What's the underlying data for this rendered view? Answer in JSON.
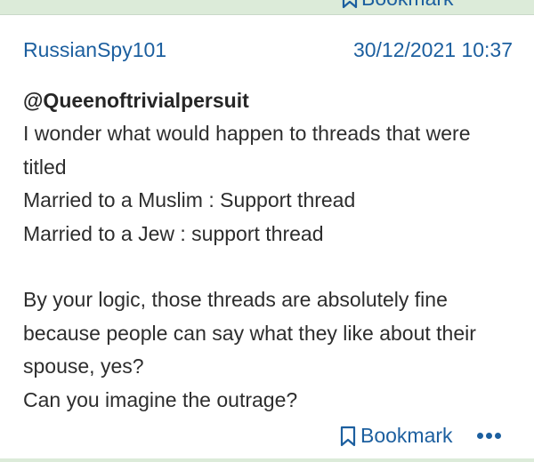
{
  "top_action": {
    "bookmark_label": "Bookmark"
  },
  "post": {
    "username": "RussianSpy101",
    "timestamp": "30/12/2021 10:37",
    "mention": "@Queenoftrivialpersuit",
    "lines": [
      "I wonder what would happen to threads that were",
      "titled",
      "Married to a Muslim : Support thread",
      "Married to a Jew : support thread",
      "",
      "By your logic, those threads are absolutely fine",
      "because people can say what they like about their",
      "spouse, yes?",
      "Can you imagine the outrage?"
    ]
  },
  "footer": {
    "bookmark_label": "Bookmark"
  },
  "colors": {
    "link": "#1c5f9f",
    "text": "#2d2d2d",
    "frame": "#dcebd9",
    "card": "#ffffff"
  },
  "icons": {
    "bookmark": "bookmark-icon",
    "more": "more-options-icon"
  }
}
